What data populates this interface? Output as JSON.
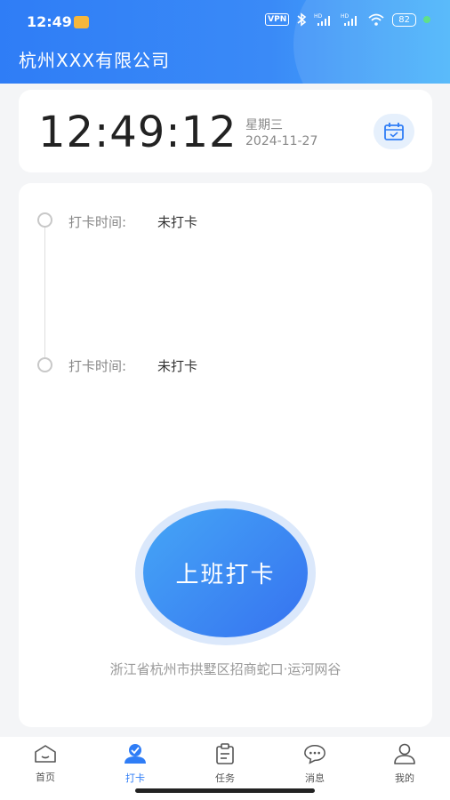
{
  "status_bar": {
    "time": "12:49",
    "vpn": "VPN",
    "battery": "82"
  },
  "header": {
    "company": "杭州XXX有限公司"
  },
  "clock": {
    "time": "12:49:12",
    "weekday": "星期三",
    "date": "2024-11-27"
  },
  "records": [
    {
      "label": "打卡时间:",
      "value": "未打卡"
    },
    {
      "label": "打卡时间:",
      "value": "未打卡"
    }
  ],
  "punch_button": {
    "label": "上班打卡"
  },
  "location": {
    "address": "浙江省杭州市拱墅区招商蛇口·运河网谷"
  },
  "tabs": [
    {
      "label": "首页",
      "icon": "home-icon"
    },
    {
      "label": "打卡",
      "icon": "checkin-icon",
      "active": true
    },
    {
      "label": "任务",
      "icon": "clipboard-icon"
    },
    {
      "label": "消息",
      "icon": "chat-icon"
    },
    {
      "label": "我的",
      "icon": "user-icon"
    }
  ],
  "colors": {
    "primary": "#2f7df6",
    "header_end": "#48b4fa",
    "background": "#f4f5f7"
  }
}
